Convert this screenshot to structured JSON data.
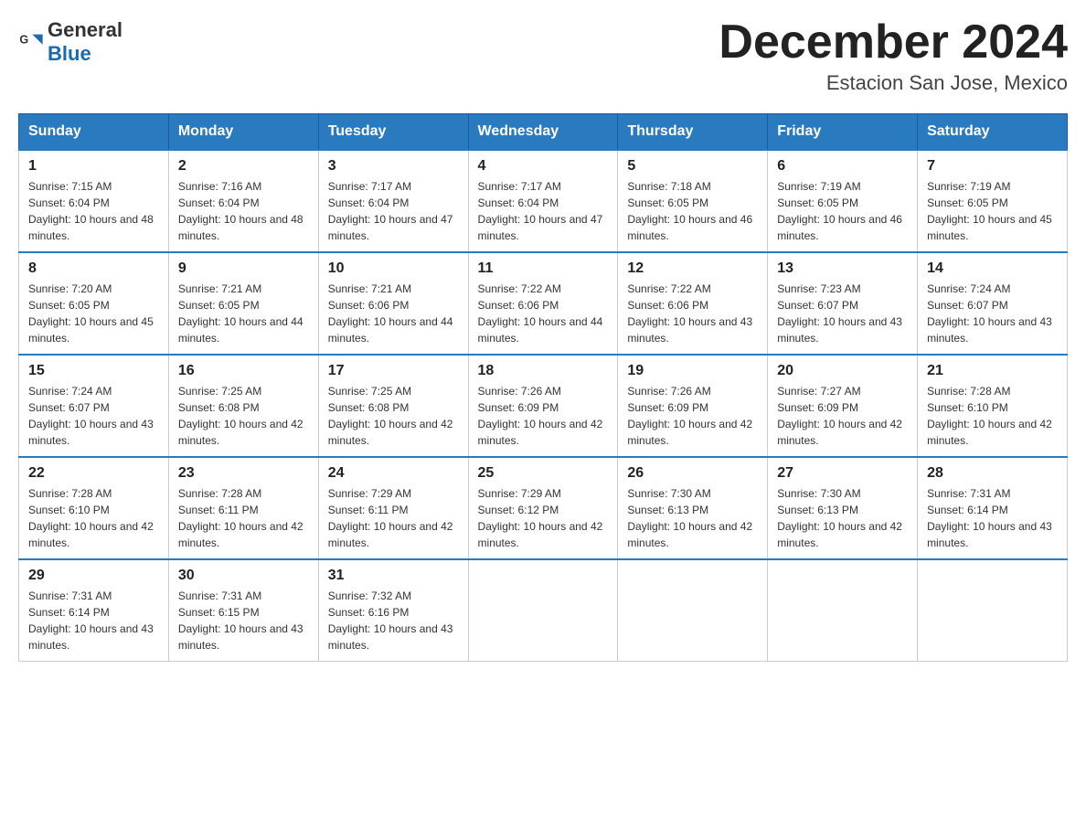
{
  "header": {
    "logo": {
      "text_general": "General",
      "text_blue": "Blue",
      "icon_label": "general-blue-logo"
    },
    "month_title": "December 2024",
    "location": "Estacion San Jose, Mexico"
  },
  "calendar": {
    "days_of_week": [
      "Sunday",
      "Monday",
      "Tuesday",
      "Wednesday",
      "Thursday",
      "Friday",
      "Saturday"
    ],
    "weeks": [
      [
        {
          "day": "1",
          "sunrise": "7:15 AM",
          "sunset": "6:04 PM",
          "daylight": "10 hours and 48 minutes."
        },
        {
          "day": "2",
          "sunrise": "7:16 AM",
          "sunset": "6:04 PM",
          "daylight": "10 hours and 48 minutes."
        },
        {
          "day": "3",
          "sunrise": "7:17 AM",
          "sunset": "6:04 PM",
          "daylight": "10 hours and 47 minutes."
        },
        {
          "day": "4",
          "sunrise": "7:17 AM",
          "sunset": "6:04 PM",
          "daylight": "10 hours and 47 minutes."
        },
        {
          "day": "5",
          "sunrise": "7:18 AM",
          "sunset": "6:05 PM",
          "daylight": "10 hours and 46 minutes."
        },
        {
          "day": "6",
          "sunrise": "7:19 AM",
          "sunset": "6:05 PM",
          "daylight": "10 hours and 46 minutes."
        },
        {
          "day": "7",
          "sunrise": "7:19 AM",
          "sunset": "6:05 PM",
          "daylight": "10 hours and 45 minutes."
        }
      ],
      [
        {
          "day": "8",
          "sunrise": "7:20 AM",
          "sunset": "6:05 PM",
          "daylight": "10 hours and 45 minutes."
        },
        {
          "day": "9",
          "sunrise": "7:21 AM",
          "sunset": "6:05 PM",
          "daylight": "10 hours and 44 minutes."
        },
        {
          "day": "10",
          "sunrise": "7:21 AM",
          "sunset": "6:06 PM",
          "daylight": "10 hours and 44 minutes."
        },
        {
          "day": "11",
          "sunrise": "7:22 AM",
          "sunset": "6:06 PM",
          "daylight": "10 hours and 44 minutes."
        },
        {
          "day": "12",
          "sunrise": "7:22 AM",
          "sunset": "6:06 PM",
          "daylight": "10 hours and 43 minutes."
        },
        {
          "day": "13",
          "sunrise": "7:23 AM",
          "sunset": "6:07 PM",
          "daylight": "10 hours and 43 minutes."
        },
        {
          "day": "14",
          "sunrise": "7:24 AM",
          "sunset": "6:07 PM",
          "daylight": "10 hours and 43 minutes."
        }
      ],
      [
        {
          "day": "15",
          "sunrise": "7:24 AM",
          "sunset": "6:07 PM",
          "daylight": "10 hours and 43 minutes."
        },
        {
          "day": "16",
          "sunrise": "7:25 AM",
          "sunset": "6:08 PM",
          "daylight": "10 hours and 42 minutes."
        },
        {
          "day": "17",
          "sunrise": "7:25 AM",
          "sunset": "6:08 PM",
          "daylight": "10 hours and 42 minutes."
        },
        {
          "day": "18",
          "sunrise": "7:26 AM",
          "sunset": "6:09 PM",
          "daylight": "10 hours and 42 minutes."
        },
        {
          "day": "19",
          "sunrise": "7:26 AM",
          "sunset": "6:09 PM",
          "daylight": "10 hours and 42 minutes."
        },
        {
          "day": "20",
          "sunrise": "7:27 AM",
          "sunset": "6:09 PM",
          "daylight": "10 hours and 42 minutes."
        },
        {
          "day": "21",
          "sunrise": "7:28 AM",
          "sunset": "6:10 PM",
          "daylight": "10 hours and 42 minutes."
        }
      ],
      [
        {
          "day": "22",
          "sunrise": "7:28 AM",
          "sunset": "6:10 PM",
          "daylight": "10 hours and 42 minutes."
        },
        {
          "day": "23",
          "sunrise": "7:28 AM",
          "sunset": "6:11 PM",
          "daylight": "10 hours and 42 minutes."
        },
        {
          "day": "24",
          "sunrise": "7:29 AM",
          "sunset": "6:11 PM",
          "daylight": "10 hours and 42 minutes."
        },
        {
          "day": "25",
          "sunrise": "7:29 AM",
          "sunset": "6:12 PM",
          "daylight": "10 hours and 42 minutes."
        },
        {
          "day": "26",
          "sunrise": "7:30 AM",
          "sunset": "6:13 PM",
          "daylight": "10 hours and 42 minutes."
        },
        {
          "day": "27",
          "sunrise": "7:30 AM",
          "sunset": "6:13 PM",
          "daylight": "10 hours and 42 minutes."
        },
        {
          "day": "28",
          "sunrise": "7:31 AM",
          "sunset": "6:14 PM",
          "daylight": "10 hours and 43 minutes."
        }
      ],
      [
        {
          "day": "29",
          "sunrise": "7:31 AM",
          "sunset": "6:14 PM",
          "daylight": "10 hours and 43 minutes."
        },
        {
          "day": "30",
          "sunrise": "7:31 AM",
          "sunset": "6:15 PM",
          "daylight": "10 hours and 43 minutes."
        },
        {
          "day": "31",
          "sunrise": "7:32 AM",
          "sunset": "6:16 PM",
          "daylight": "10 hours and 43 minutes."
        },
        null,
        null,
        null,
        null
      ]
    ]
  }
}
